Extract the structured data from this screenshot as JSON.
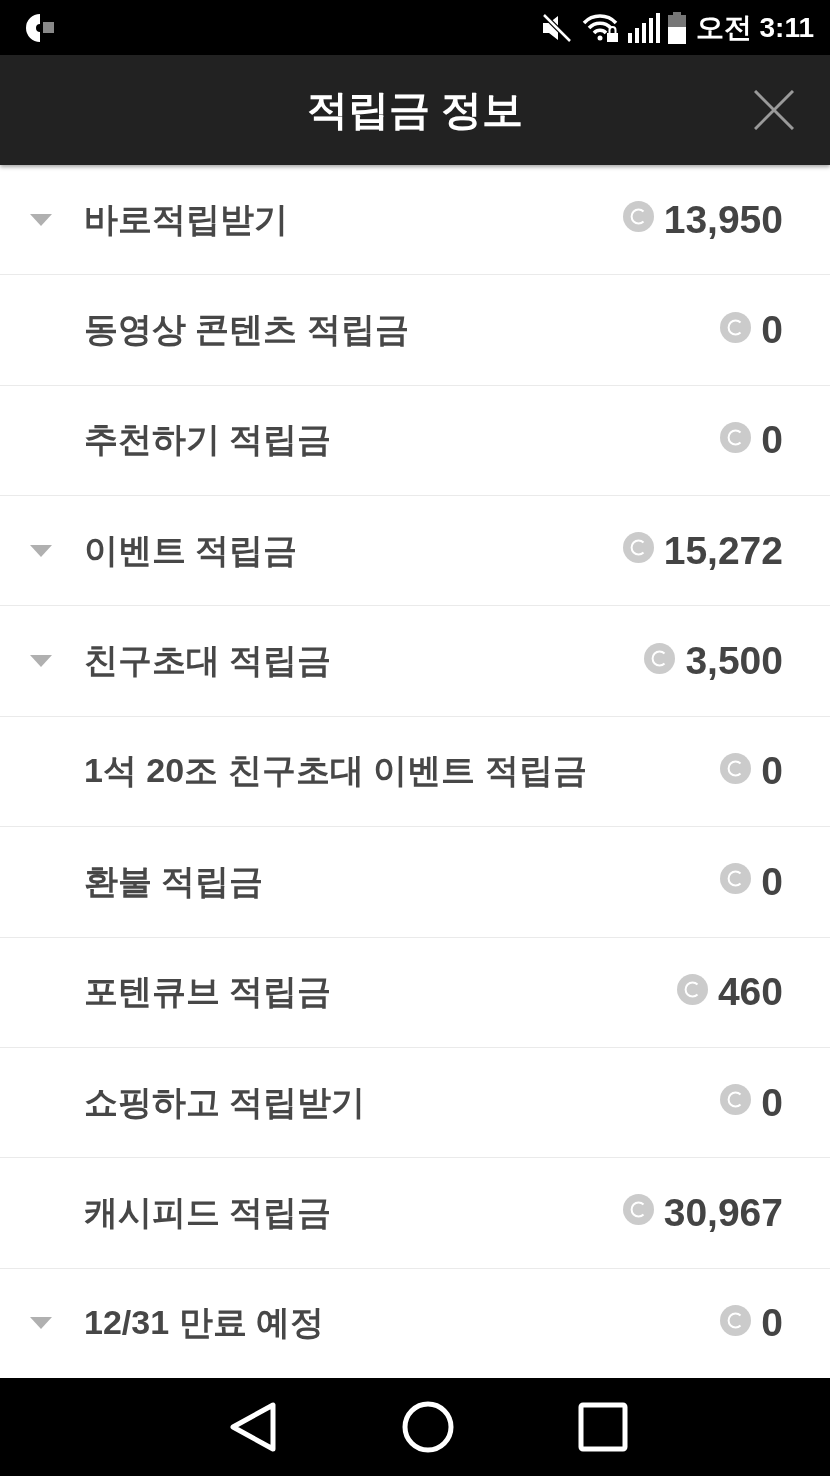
{
  "status_bar": {
    "time": "오전 3:11"
  },
  "header": {
    "title": "적립금 정보"
  },
  "rows": [
    {
      "kind": "expandable",
      "label": "바로적립받기",
      "amount": "13,950"
    },
    {
      "kind": "plain",
      "label": "동영상 콘텐츠 적립금",
      "amount": "0"
    },
    {
      "kind": "plain",
      "label": "추천하기 적립금",
      "amount": "0"
    },
    {
      "kind": "expandable",
      "label": "이벤트 적립금",
      "amount": "15,272"
    },
    {
      "kind": "expandable",
      "label": "친구초대 적립금",
      "amount": "3,500"
    },
    {
      "kind": "plain",
      "label": "1석 20조 친구초대 이벤트 적립금",
      "amount": "0"
    },
    {
      "kind": "plain",
      "label": "환불 적립금",
      "amount": "0"
    },
    {
      "kind": "plain",
      "label": "포텐큐브 적립금",
      "amount": "460"
    },
    {
      "kind": "plain",
      "label": "쇼핑하고 적립받기",
      "amount": "0"
    },
    {
      "kind": "plain",
      "label": "캐시피드 적립금",
      "amount": "30,967"
    },
    {
      "kind": "expandable",
      "label": "12/31 만료 예정",
      "amount": "0"
    }
  ]
}
